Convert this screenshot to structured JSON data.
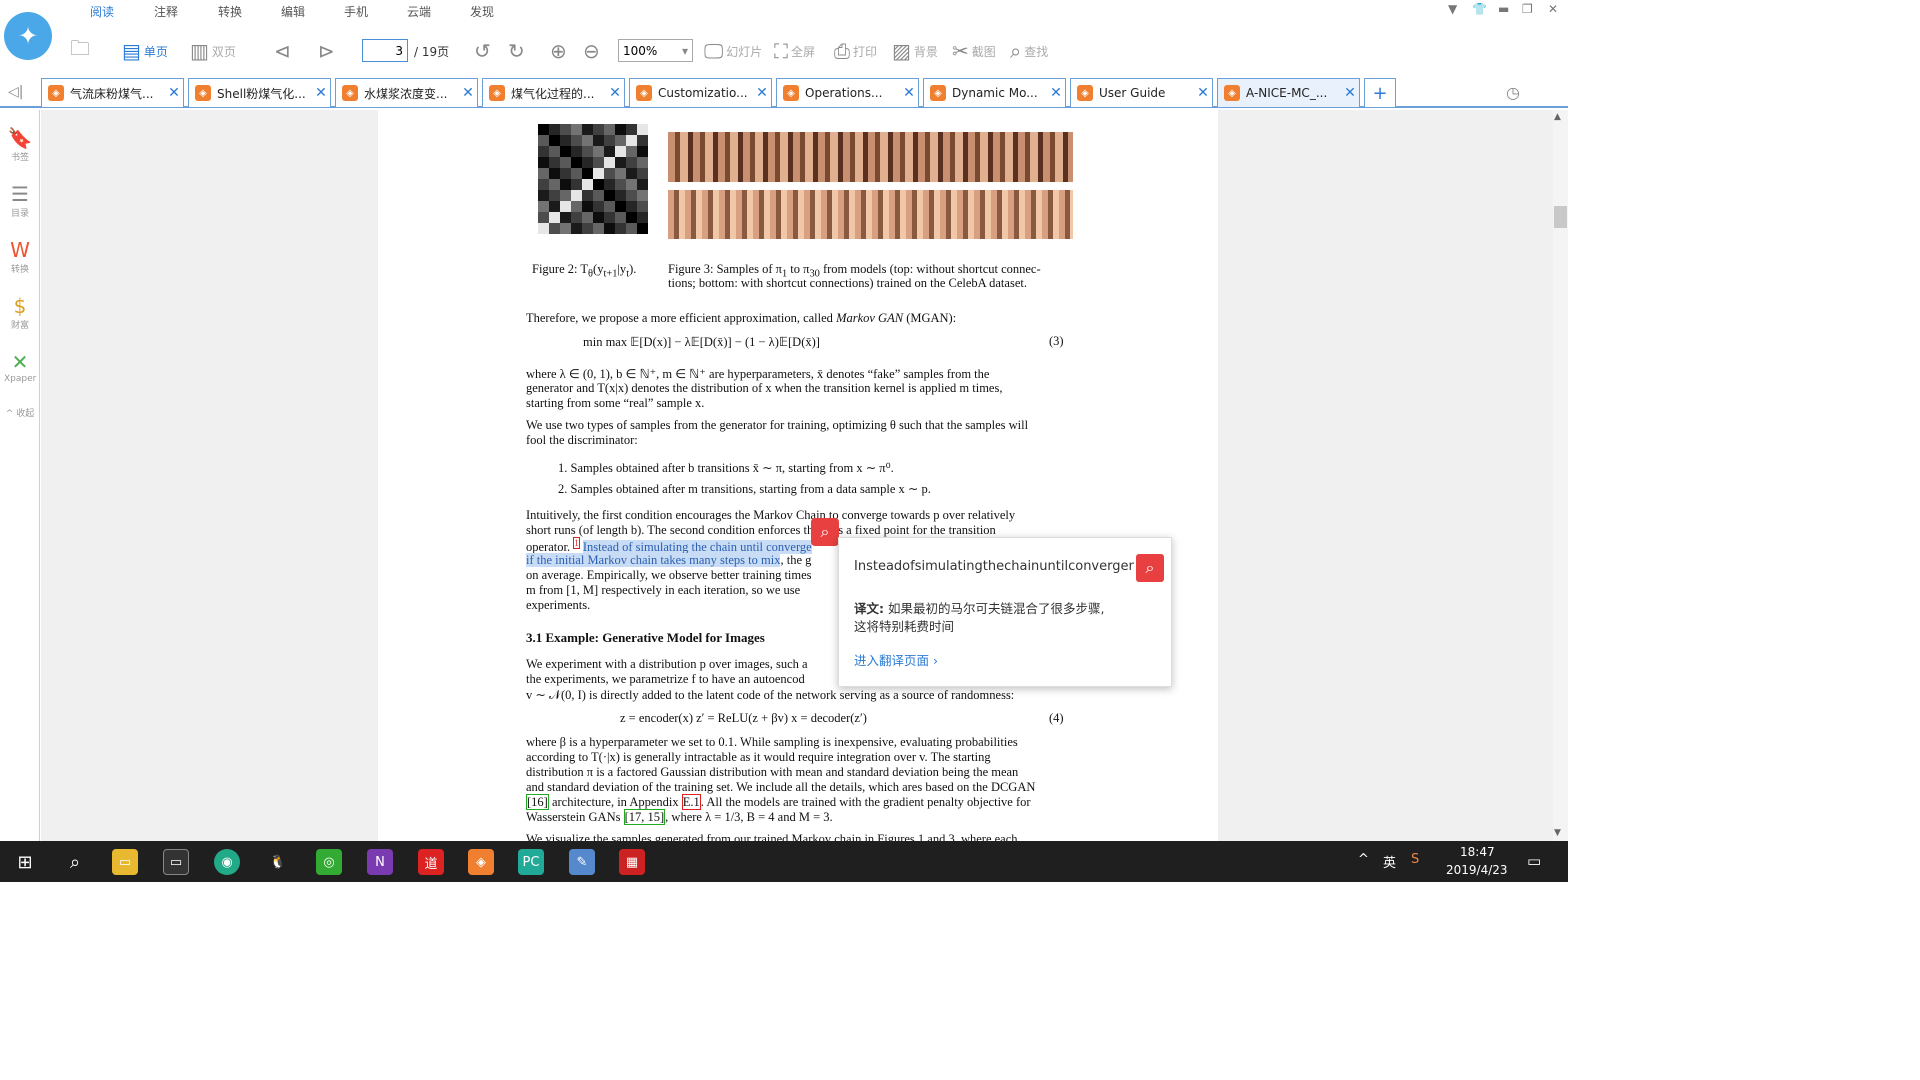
{
  "menu": [
    "阅读",
    "注释",
    "转换",
    "编辑",
    "手机",
    "云端",
    "发现"
  ],
  "toolbar": {
    "single_page": "单页",
    "double_page": "双页",
    "page_current": "3",
    "page_total": "/ 19页",
    "zoom": "100%",
    "slideshow": "幻灯片",
    "fullscreen": "全屏",
    "print": "打印",
    "background": "背景",
    "screenshot": "截图",
    "find": "查找"
  },
  "tabs": [
    "气流床粉煤气...",
    "Shell粉煤气化...",
    "水煤浆浓度变...",
    "煤气化过程的...",
    "Customizatio...",
    "Operations...",
    "Dynamic Mo...",
    "User Guide",
    "A-NICE-MC_..."
  ],
  "sidebar": [
    "书签",
    "目录",
    "转换",
    "财富",
    "Xpaper",
    "收起"
  ],
  "doc": {
    "fig2": "Figure 2: T",
    "fig2b": "(y",
    "fig2c": "|y",
    "fig3_l1": "Figure 3: Samples of π",
    "fig3_l1b": " to π",
    "fig3_l1c": " from models (top: without shortcut connec-",
    "fig3_l2": "tions; bottom: with shortcut connections) trained on the CelebA dataset.",
    "p1": "Therefore, we propose a more efficient approximation, called ",
    "p1_em": "Markov GAN",
    "p1_end": " (MGAN):",
    "eq3": "min max 𝔼[D(x)] − λ𝔼[D(x̄)] − (1 − λ)𝔼[D(x̄)]",
    "eq3_num": "(3)",
    "p2_l1": "where λ ∈ (0, 1), b ∈ ℕ⁺, m ∈ ℕ⁺ are hyperparameters, x̄ denotes “fake” samples from the",
    "p2_l2": "generator and T(x|x) denotes the distribution of x when the transition kernel is applied m times,",
    "p2_l3": "starting from some “real” sample x.",
    "p3_l1": "We use two types of samples from the generator for training, optimizing θ such that the samples will",
    "p3_l2": "fool the discriminator:",
    "li1": "1.  Samples obtained after b transitions x̄ ∼ π, starting from x ∼ π⁰.",
    "li2": "2.  Samples obtained after m transitions, starting from a data sample x ∼ p.",
    "p4_l1": "Intuitively, the first condition encourages the Markov Chain to converge towards p over relatively",
    "p4_l2": "short runs (of length b).  The second condition enforces that p is a fixed point for the transition",
    "p4_l3a": "operator.",
    "p4_l3b": "Instead of simulating the chain until converge",
    "p4_l4a": "if the initial Markov chain takes many steps to mix",
    "p4_l4b": ", the g",
    "p4_l5": "on average. Empirically, we observe better training times",
    "p4_l6": "m from [1, M] respectively in each iteration, so we use",
    "p4_l7": "experiments.",
    "sec": "3.1    Example: Generative Model for Images",
    "p5_l1": "We experiment with a distribution p over images, such a",
    "p5_l2": "the experiments, we parametrize f to have an autoencod",
    "p5_l3": "v ∼ 𝒩(0, I) is directly added to the latent code of the network serving as a source of randomness:",
    "eq4": "z = encoder(x)    z′ = ReLU(z + βv)    x = decoder(z′)",
    "eq4_num": "(4)",
    "p6_l1": "where β is a hyperparameter we set to 0.1. While sampling is inexpensive, evaluating probabilities",
    "p6_l2": "according to T(·|x) is generally intractable as it would require integration over v. The starting",
    "p6_l3": "distribution π is a factored Gaussian distribution with mean and standard deviation being the mean",
    "p6_l4": "and standard deviation of the training set. We include all the details, which ares based on the DCGAN",
    "p6_l5a": "[16]",
    "p6_l5b": " architecture, in Appendix ",
    "p6_l5c": "E.1",
    "p6_l5d": ". All the models are trained with the gradient penalty objective for",
    "p6_l6a": "Wasserstein GANs ",
    "p6_l6b": "[17, 15]",
    "p6_l6c": ", where λ = 1/3, B = 4 and M = 3.",
    "p7": "We visualize the samples generated from our trained Markov chain in Figures 1 and 3, where each"
  },
  "popup": {
    "query": "Insteadofsimulatingthechainuntilconvergenc",
    "label": "译文:",
    "translation_l1": "如果最初的马尔可夫链混合了很多步骤,",
    "translation_l2": "这将特别耗费时间",
    "link": "进入翻译页面"
  },
  "taskbar": {
    "lang": "英",
    "time": "18:47",
    "date": "2019/4/23"
  }
}
